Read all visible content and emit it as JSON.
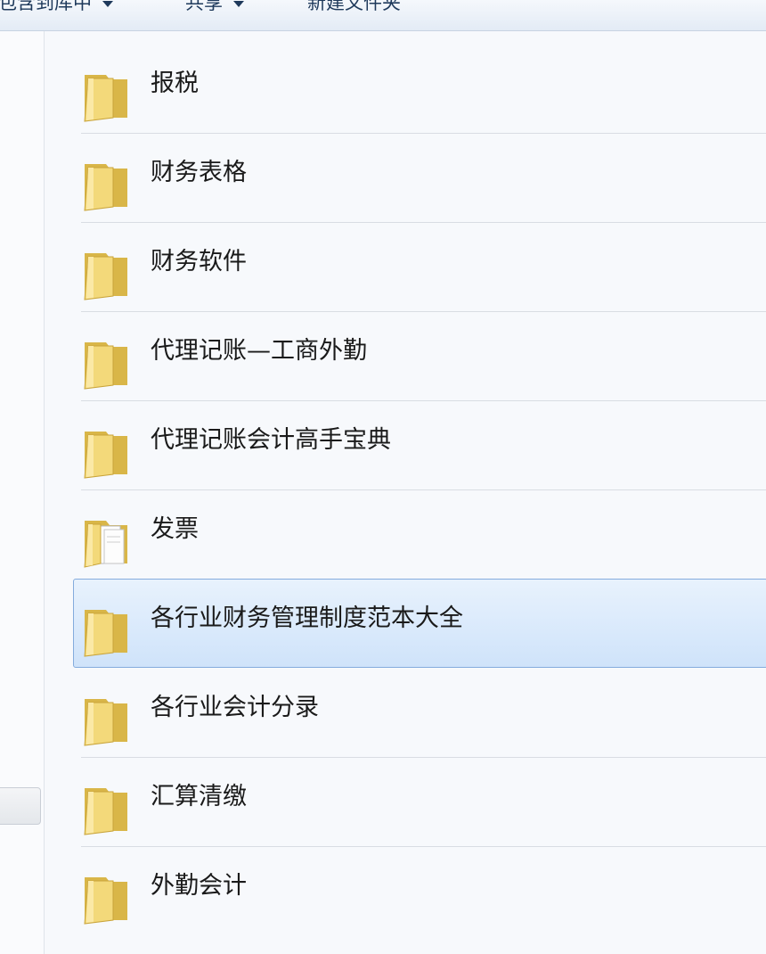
{
  "toolbar": {
    "include_in_library": "包含到库中",
    "share": "共享",
    "new_folder": "新建文件夹"
  },
  "files": [
    {
      "name": "报税",
      "icon": "folder-icon"
    },
    {
      "name": "财务表格",
      "icon": "folder-icon"
    },
    {
      "name": "财务软件",
      "icon": "folder-icon"
    },
    {
      "name": "代理记账—工商外勤",
      "icon": "folder-icon"
    },
    {
      "name": "代理记账会计高手宝典",
      "icon": "folder-icon"
    },
    {
      "name": "发票",
      "icon": "folder-with-documents-icon"
    },
    {
      "name": "各行业财务管理制度范本大全",
      "icon": "folder-icon",
      "selected": true
    },
    {
      "name": "各行业会计分录",
      "icon": "folder-icon"
    },
    {
      "name": "汇算清缴",
      "icon": "folder-icon"
    },
    {
      "name": "外勤会计",
      "icon": "folder-icon"
    }
  ],
  "colors": {
    "folder_front": "#f3d97a",
    "folder_back": "#d9b648",
    "selection_bg": "#cfe3fa",
    "selection_border": "#84acdd",
    "toolbar_text": "#1e395b"
  }
}
